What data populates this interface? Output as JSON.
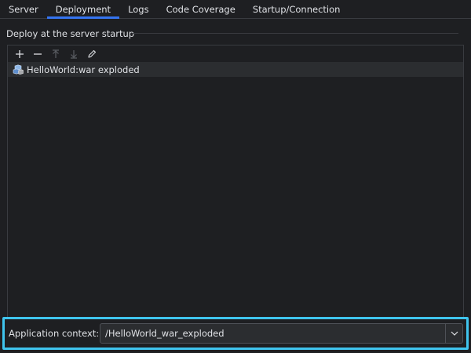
{
  "tabs": [
    {
      "label": "Server",
      "active": false
    },
    {
      "label": "Deployment",
      "active": true
    },
    {
      "label": "Logs",
      "active": false
    },
    {
      "label": "Code Coverage",
      "active": false
    },
    {
      "label": "Startup/Connection",
      "active": false
    }
  ],
  "section": {
    "title": "Deploy at the server startup"
  },
  "toolbar": {
    "icons": [
      "add-icon",
      "remove-icon",
      "move-up-icon",
      "move-down-icon",
      "edit-icon"
    ]
  },
  "deployments": [
    {
      "label": "HelloWorld:war exploded",
      "icon": "artifact-icon",
      "selected": true
    }
  ],
  "context": {
    "label": "Application context:",
    "value": "/HelloWorld_war_exploded"
  },
  "colors": {
    "background": "#1e1f22",
    "accent_tab": "#3574f0",
    "highlight_border": "#3fc4ee",
    "text": "#dfe1e5"
  }
}
